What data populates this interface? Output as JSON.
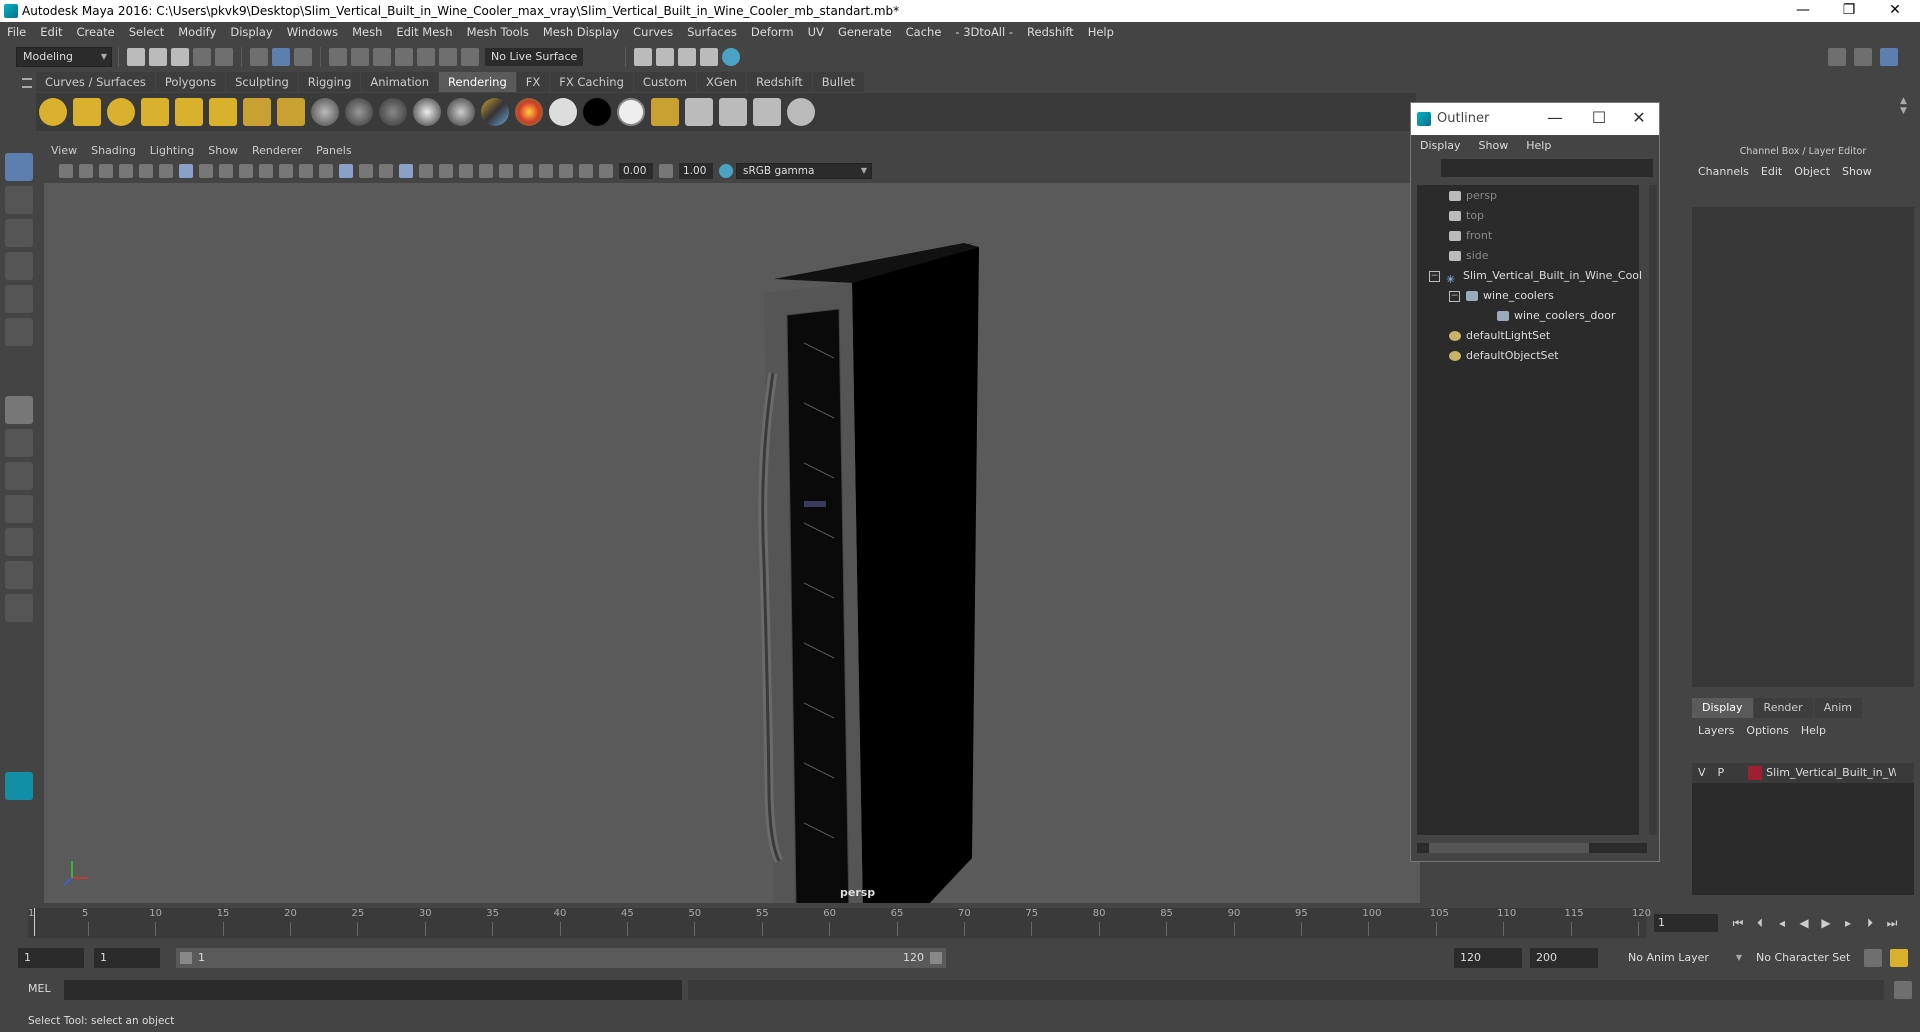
{
  "window": {
    "title": "Autodesk Maya 2016: C:\\Users\\pkvk9\\Desktop\\Slim_Vertical_Built_in_Wine_Cooler_max_vray\\Slim_Vertical_Built_in_Wine_Cooler_mb_standart.mb*",
    "minimize": "—",
    "maximize": "❐",
    "close": "✕"
  },
  "menubar": [
    "File",
    "Edit",
    "Create",
    "Select",
    "Modify",
    "Display",
    "Windows",
    "Mesh",
    "Edit Mesh",
    "Mesh Tools",
    "Mesh Display",
    "Curves",
    "Surfaces",
    "Deform",
    "UV",
    "Generate",
    "Cache",
    "- 3DtoAll -",
    "Redshift",
    "Help"
  ],
  "statusline": {
    "mode": "Modeling",
    "live_surface": "No Live Surface"
  },
  "shelf_tabs": [
    "Curves / Surfaces",
    "Polygons",
    "Sculpting",
    "Rigging",
    "Animation",
    "Rendering",
    "FX",
    "FX Caching",
    "Custom",
    "XGen",
    "Redshift",
    "Bullet"
  ],
  "active_shelf_tab": "Rendering",
  "viewport": {
    "menu": [
      "View",
      "Shading",
      "Lighting",
      "Show",
      "Renderer",
      "Panels"
    ],
    "exposure": "0.00",
    "gamma": "1.00",
    "color_space": "sRGB gamma",
    "camera_label": "persp"
  },
  "outliner": {
    "title": "Outliner",
    "menu": [
      "Display",
      "Show",
      "Help"
    ],
    "items": [
      {
        "label": "persp",
        "kind": "camera",
        "dim": true
      },
      {
        "label": "top",
        "kind": "camera",
        "dim": true
      },
      {
        "label": "front",
        "kind": "camera",
        "dim": true
      },
      {
        "label": "side",
        "kind": "camera",
        "dim": true
      },
      {
        "label": "Slim_Vertical_Built_in_Wine_Cool",
        "kind": "group"
      },
      {
        "label": "wine_coolers",
        "kind": "mesh"
      },
      {
        "label": "wine_coolers_door",
        "kind": "mesh"
      },
      {
        "label": "defaultLightSet",
        "kind": "set"
      },
      {
        "label": "defaultObjectSet",
        "kind": "set"
      }
    ]
  },
  "channel_box": {
    "title": "Channel Box / Layer Editor",
    "menu": [
      "Channels",
      "Edit",
      "Object",
      "Show"
    ],
    "layer_tabs": [
      "Display",
      "Render",
      "Anim"
    ],
    "active_layer_tab": "Display",
    "layer_menu": [
      "Layers",
      "Options",
      "Help"
    ],
    "layer": {
      "v": "V",
      "p": "P",
      "name": "Slim_Vertical_Built_in_Wi",
      "color": "#9e1f32"
    }
  },
  "timeline": {
    "ticks": [
      "5",
      "10",
      "15",
      "20",
      "25",
      "30",
      "35",
      "40",
      "45",
      "50",
      "55",
      "60",
      "65",
      "70",
      "75",
      "80",
      "85",
      "90",
      "95",
      "100",
      "105",
      "110",
      "115",
      "120"
    ],
    "start_tick": "1",
    "current_time": "1"
  },
  "range": {
    "start": "1",
    "playback_start": "1",
    "slider_start": "1",
    "slider_end": "120",
    "playback_end": "120",
    "end": "200",
    "anim_layer": "No Anim Layer",
    "character_set": "No Character Set"
  },
  "cmdline": {
    "label": "MEL"
  },
  "helpline": {
    "text": "Select Tool: select an object"
  }
}
